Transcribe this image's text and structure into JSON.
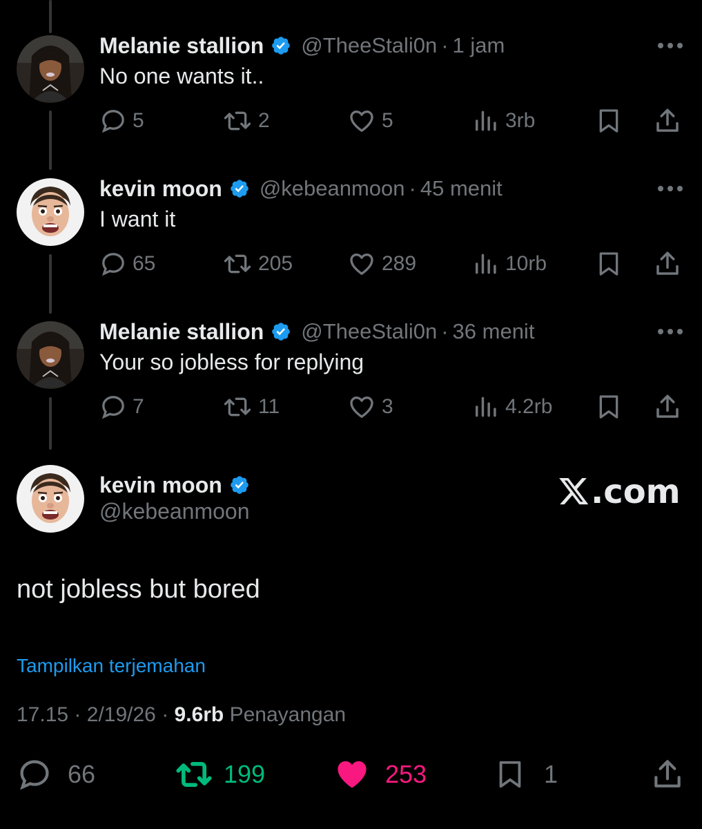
{
  "tweets": [
    {
      "name": "Melanie stallion",
      "handle": "@TheeStali0n",
      "time": "1 jam",
      "text": "No one wants it..",
      "replies": "5",
      "retweets": "2",
      "likes": "5",
      "views": "3rb",
      "avatar": "woman-avatar"
    },
    {
      "name": "kevin moon",
      "handle": "@kebeanmoon",
      "time": "45 menit",
      "text": "I want it",
      "replies": "65",
      "retweets": "205",
      "likes": "289",
      "views": "10rb",
      "avatar": "man-avatar"
    },
    {
      "name": "Melanie stallion",
      "handle": "@TheeStali0n",
      "time": "36 menit",
      "text": "Your so jobless for replying",
      "replies": "7",
      "retweets": "11",
      "likes": "3",
      "views": "4.2rb",
      "avatar": "woman-avatar"
    }
  ],
  "main": {
    "name": "kevin moon",
    "handle": "@kebeanmoon",
    "text": "not jobless but bored",
    "translate": "Tampilkan terjemahan",
    "time": "17.15",
    "date": "2/19/26",
    "views": "9.6rb",
    "views_label": "Penayangan",
    "replies": "66",
    "retweets": "199",
    "likes": "253",
    "bookmarks": "1",
    "watermark": "com"
  },
  "separator": "·",
  "colors": {
    "background": "#000000",
    "text": "#e7e9ea",
    "muted": "#71767b",
    "link": "#1d9bf0",
    "verified": "#1d9bf0",
    "retweet_active": "#00ba7c",
    "like_active": "#f91880"
  }
}
